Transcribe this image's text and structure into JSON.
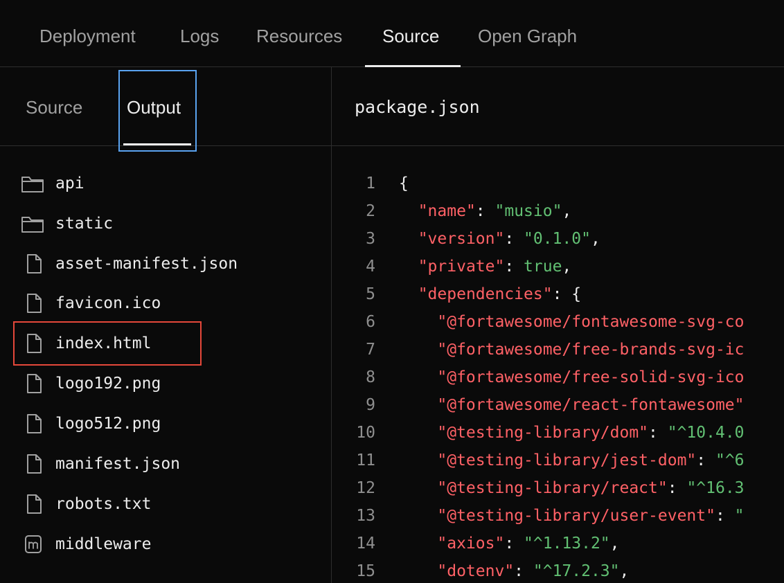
{
  "top_tabs": [
    {
      "label": "Deployment",
      "active": false
    },
    {
      "label": "Logs",
      "active": false
    },
    {
      "label": "Resources",
      "active": false
    },
    {
      "label": "Source",
      "active": true
    },
    {
      "label": "Open Graph",
      "active": false
    }
  ],
  "sub_tabs": [
    {
      "label": "Source",
      "active": false
    },
    {
      "label": "Output",
      "active": true
    }
  ],
  "files": [
    {
      "name": "api",
      "type": "folder",
      "icon": "folder-icon"
    },
    {
      "name": "static",
      "type": "folder",
      "icon": "folder-icon"
    },
    {
      "name": "asset-manifest.json",
      "type": "file",
      "icon": "file-icon"
    },
    {
      "name": "favicon.ico",
      "type": "file",
      "icon": "file-icon"
    },
    {
      "name": "index.html",
      "type": "file",
      "icon": "file-icon",
      "highlighted": true
    },
    {
      "name": "logo192.png",
      "type": "file",
      "icon": "file-icon"
    },
    {
      "name": "logo512.png",
      "type": "file",
      "icon": "file-icon"
    },
    {
      "name": "manifest.json",
      "type": "file",
      "icon": "file-icon"
    },
    {
      "name": "robots.txt",
      "type": "file",
      "icon": "file-icon"
    },
    {
      "name": "middleware",
      "type": "middleware",
      "icon": "middleware-icon"
    }
  ],
  "editor": {
    "filename": "package.json",
    "lines": [
      {
        "n": "1",
        "indent": "",
        "key": "",
        "sep": "{",
        "val": "",
        "tail": ""
      },
      {
        "n": "2",
        "indent": "  ",
        "key": "\"name\"",
        "sep": ": ",
        "val": "\"musio\"",
        "tail": ","
      },
      {
        "n": "3",
        "indent": "  ",
        "key": "\"version\"",
        "sep": ": ",
        "val": "\"0.1.0\"",
        "tail": ","
      },
      {
        "n": "4",
        "indent": "  ",
        "key": "\"private\"",
        "sep": ": ",
        "val": "true",
        "tail": ","
      },
      {
        "n": "5",
        "indent": "  ",
        "key": "\"dependencies\"",
        "sep": ": {",
        "val": "",
        "tail": ""
      },
      {
        "n": "6",
        "indent": "    ",
        "key": "\"@fortawesome/fontawesome-svg-co",
        "sep": "",
        "val": "",
        "tail": ""
      },
      {
        "n": "7",
        "indent": "    ",
        "key": "\"@fortawesome/free-brands-svg-ic",
        "sep": "",
        "val": "",
        "tail": ""
      },
      {
        "n": "8",
        "indent": "    ",
        "key": "\"@fortawesome/free-solid-svg-ico",
        "sep": "",
        "val": "",
        "tail": ""
      },
      {
        "n": "9",
        "indent": "    ",
        "key": "\"@fortawesome/react-fontawesome\"",
        "sep": "",
        "val": "",
        "tail": ""
      },
      {
        "n": "10",
        "indent": "    ",
        "key": "\"@testing-library/dom\"",
        "sep": ": ",
        "val": "\"^10.4.0",
        "tail": ""
      },
      {
        "n": "11",
        "indent": "    ",
        "key": "\"@testing-library/jest-dom\"",
        "sep": ": ",
        "val": "\"^6",
        "tail": ""
      },
      {
        "n": "12",
        "indent": "    ",
        "key": "\"@testing-library/react\"",
        "sep": ": ",
        "val": "\"^16.3",
        "tail": ""
      },
      {
        "n": "13",
        "indent": "    ",
        "key": "\"@testing-library/user-event\"",
        "sep": ": ",
        "val": "\"",
        "tail": ""
      },
      {
        "n": "14",
        "indent": "    ",
        "key": "\"axios\"",
        "sep": ": ",
        "val": "\"^1.13.2\"",
        "tail": ","
      },
      {
        "n": "15",
        "indent": "    ",
        "key": "\"dotenv\"",
        "sep": ": ",
        "val": "\"^17.2.3\"",
        "tail": ","
      }
    ]
  },
  "colors": {
    "accent_focus": "#5aa3f0",
    "highlight": "#e5483a",
    "json_key": "#ff6166",
    "json_value": "#62c073"
  }
}
